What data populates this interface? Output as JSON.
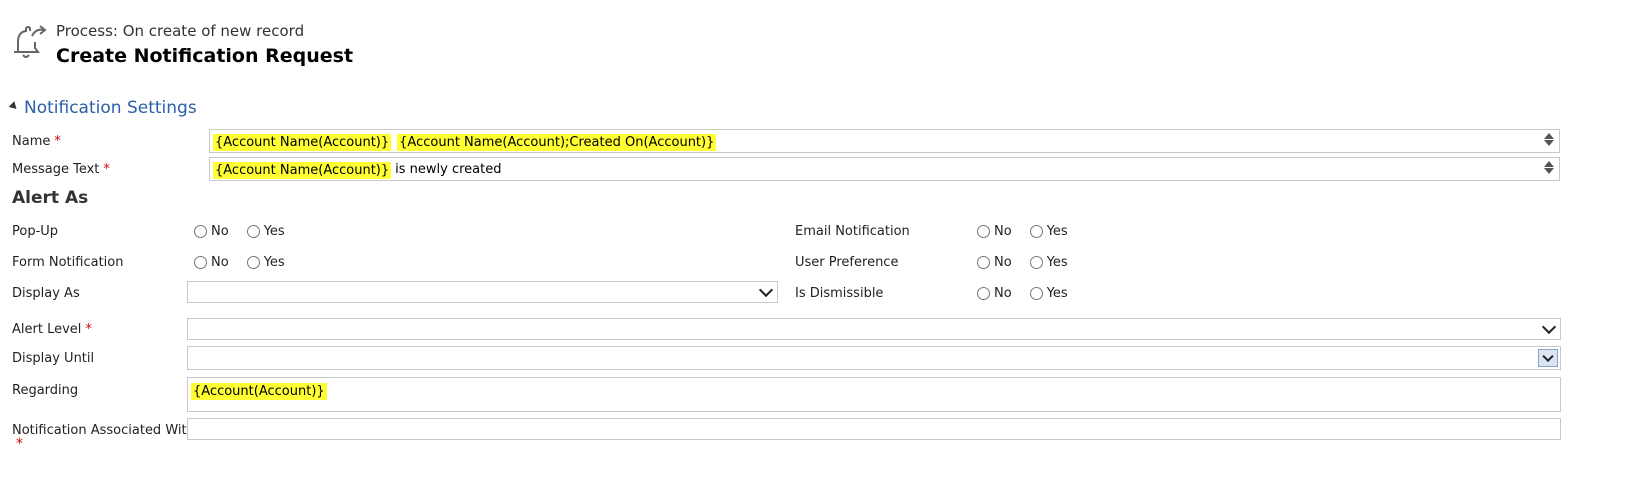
{
  "header": {
    "icon": "bell-with-arrow-icon",
    "process_line": "Process: On create of new record",
    "title": "Create Notification Request"
  },
  "section": {
    "label": "Notification Settings",
    "icon": "collapse-triangle-icon"
  },
  "fields": {
    "name": {
      "label": "Name",
      "required": "*",
      "tokens": [
        "{Account Name(Account)}",
        "{Account Name(Account);Created On(Account)}"
      ]
    },
    "message": {
      "label": "Message Text",
      "required": "*",
      "token": "{Account Name(Account)}",
      "text": "is newly created"
    },
    "regarding": {
      "label": "Regarding",
      "token": "{Account(Account)}"
    },
    "assoc": {
      "label": "Notification Associated With",
      "required": "*"
    }
  },
  "alert_as": {
    "heading": "Alert As",
    "popup": {
      "label": "Pop-Up",
      "no": "No",
      "yes": "Yes"
    },
    "form_notification": {
      "label": "Form Notification",
      "no": "No",
      "yes": "Yes"
    },
    "display_as": {
      "label": "Display As",
      "value": ""
    },
    "email_notification": {
      "label": "Email Notification",
      "no": "No",
      "yes": "Yes"
    },
    "user_preference": {
      "label": "User Preference",
      "no": "No",
      "yes": "Yes"
    },
    "is_dismissible": {
      "label": "Is Dismissible",
      "no": "No",
      "yes": "Yes"
    }
  },
  "alert_level": {
    "label": "Alert Level",
    "required": "*",
    "value": ""
  },
  "display_until": {
    "label": "Display Until",
    "value": ""
  },
  "colors": {
    "section_blue": "#2b5fa6",
    "highlight": "#ffff33",
    "required_red": "#d00000"
  }
}
